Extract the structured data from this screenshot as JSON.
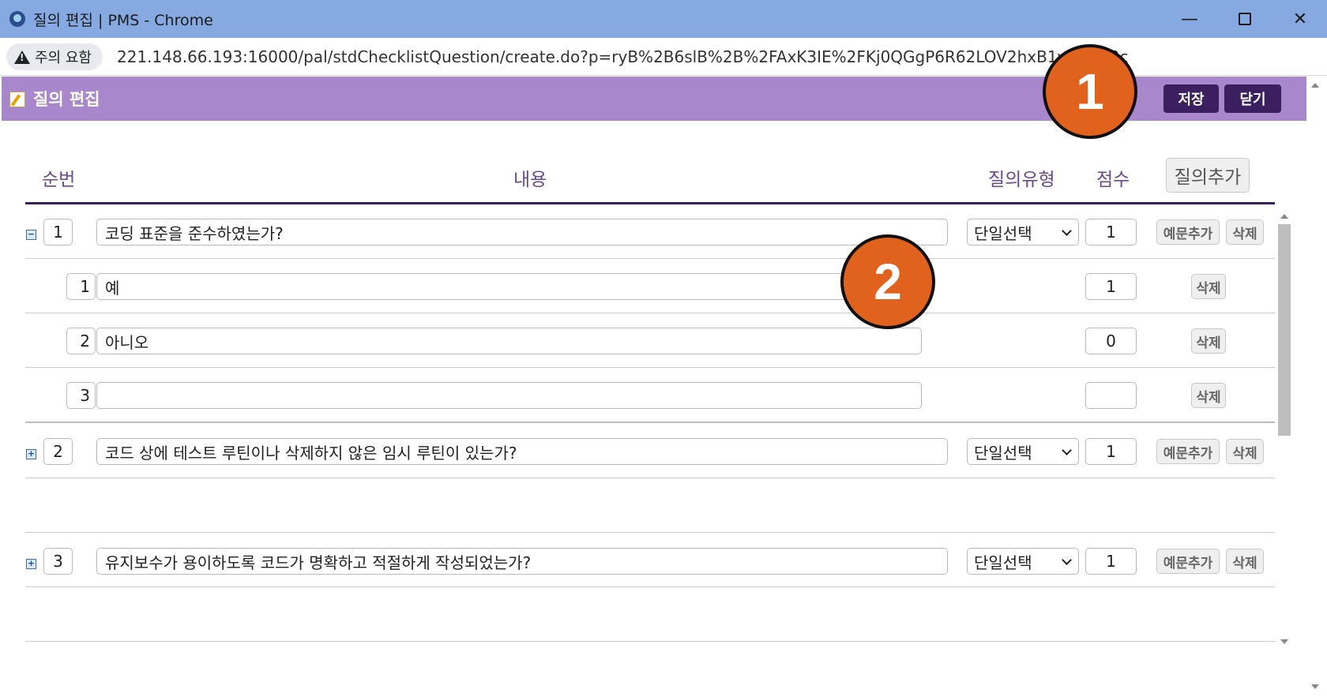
{
  "window": {
    "title": "질의 편집 | PMS - Chrome",
    "controls": {
      "minimize": "—",
      "maximize": "",
      "close": "✕"
    }
  },
  "addressbar": {
    "warning": "주의 요함",
    "url": "221.148.66.193:16000/pal/stdChecklistQuestion/create.do?p=ryB%2B6slB%2B%2FAxK3IE%2FKj0QGgP6R62LOV2hxB1vhMk33c"
  },
  "header": {
    "title": "질의 편집",
    "save_label": "저장",
    "close_label": "닫기"
  },
  "markers": [
    "1",
    "2"
  ],
  "table": {
    "col_seq": "순번",
    "col_content": "내용",
    "col_type": "질의유형",
    "col_score": "점수",
    "add_question_label": "질의추가"
  },
  "questions": [
    {
      "toggle": "−",
      "seq": "1",
      "text": "코딩 표준을 준수하였는가?",
      "type": "단일선택",
      "score": "1",
      "add_example_label": "예문추가",
      "delete_label": "삭제",
      "answers": [
        {
          "seq": "1",
          "text": "예",
          "score": "1",
          "delete_label": "삭제"
        },
        {
          "seq": "2",
          "text": "아니오",
          "score": "0",
          "delete_label": "삭제"
        },
        {
          "seq": "3",
          "text": "",
          "score": "",
          "delete_label": "삭제"
        }
      ]
    },
    {
      "toggle": "+",
      "seq": "2",
      "text": "코드 상에 테스트 루틴이나 삭제하지 않은 임시 루틴이 있는가?",
      "type": "단일선택",
      "score": "1",
      "add_example_label": "예문추가",
      "delete_label": "삭제"
    },
    {
      "toggle": "+",
      "seq": "3",
      "text": "유지보수가 용이하도록 코드가 명확하고 적절하게 작성되었는가?",
      "type": "단일선택",
      "score": "1",
      "add_example_label": "예문추가",
      "delete_label": "삭제"
    }
  ],
  "colors": {
    "titlebar": "#86a9e2",
    "header": "#a987cc",
    "header_button": "#3b1f5e",
    "marker": "#e0621c"
  }
}
